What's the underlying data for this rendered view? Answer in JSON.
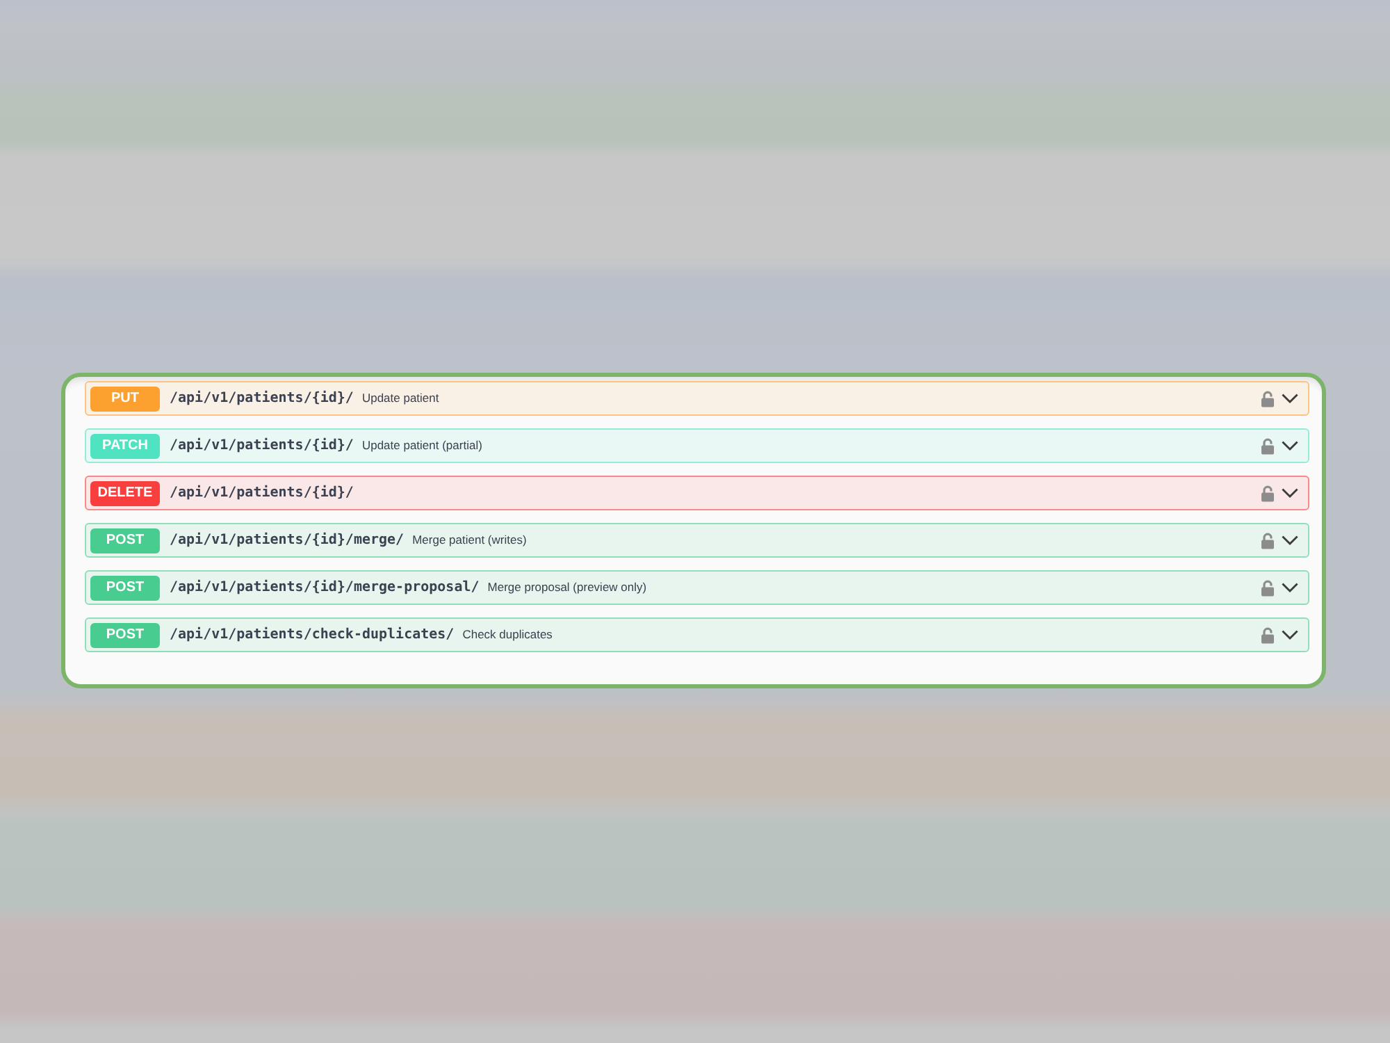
{
  "endpoints": [
    {
      "method": "PUT",
      "color": "#fca130",
      "path": "/api/v1/patients/{id}/",
      "summary": "Update patient"
    },
    {
      "method": "PATCH",
      "color": "#50e3c2",
      "path": "/api/v1/patients/{id}/",
      "summary": "Update patient (partial)"
    },
    {
      "method": "DELETE",
      "color": "#f93e3e",
      "path": "/api/v1/patients/{id}/"
    },
    {
      "method": "POST",
      "color": "#49cc90",
      "path": "/api/v1/patients/{id}/merge/",
      "summary": "Merge patient (writes)"
    },
    {
      "method": "POST",
      "color": "#49cc90",
      "path": "/api/v1/patients/{id}/merge-proposal/",
      "summary": "Merge proposal (preview only)"
    },
    {
      "method": "POST",
      "color": "#49cc90",
      "path": "/api/v1/patients/check-duplicates/",
      "summary": "Check duplicates"
    }
  ]
}
